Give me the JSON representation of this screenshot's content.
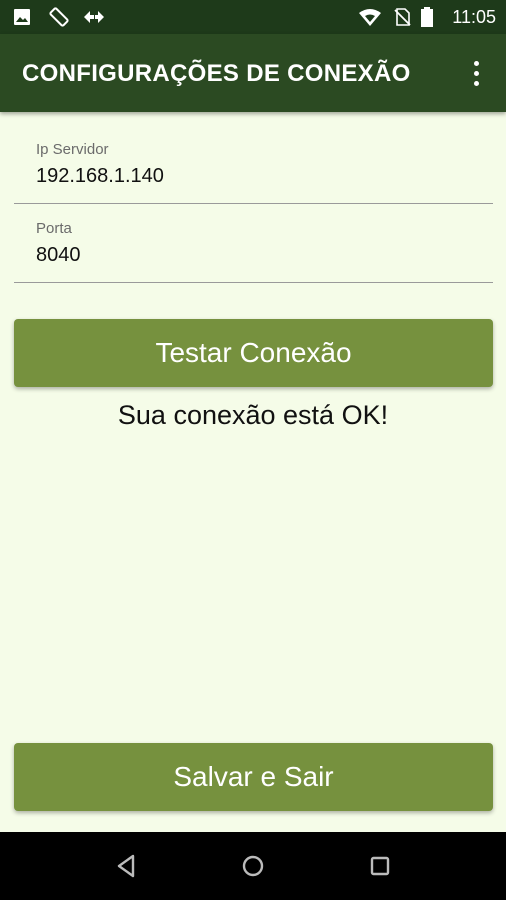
{
  "status_bar": {
    "time": "11:05",
    "icons": [
      "image-icon",
      "screen-rotation-icon",
      "data-transfer-icon",
      "wifi-icon",
      "no-sim-icon",
      "battery-icon"
    ]
  },
  "app_bar": {
    "title": "CONFIGURAÇÕES DE CONEXÃO",
    "menu_icon": "more-vert-icon"
  },
  "form": {
    "ip": {
      "label": "Ip Servidor",
      "value": "192.168.1.140"
    },
    "port": {
      "label": "Porta",
      "value": "8040"
    }
  },
  "test_button": {
    "label": "Testar Conexão"
  },
  "connection_status": "Sua conexão está OK!",
  "save_button": {
    "label": "Salvar e Sair"
  },
  "nav_bar": {
    "icons": [
      "back-icon",
      "home-icon",
      "recents-icon"
    ]
  },
  "colors": {
    "status_bar": "#1e3a1a",
    "app_bar": "#2b4a22",
    "background": "#f5fce8",
    "button": "#76913e"
  }
}
